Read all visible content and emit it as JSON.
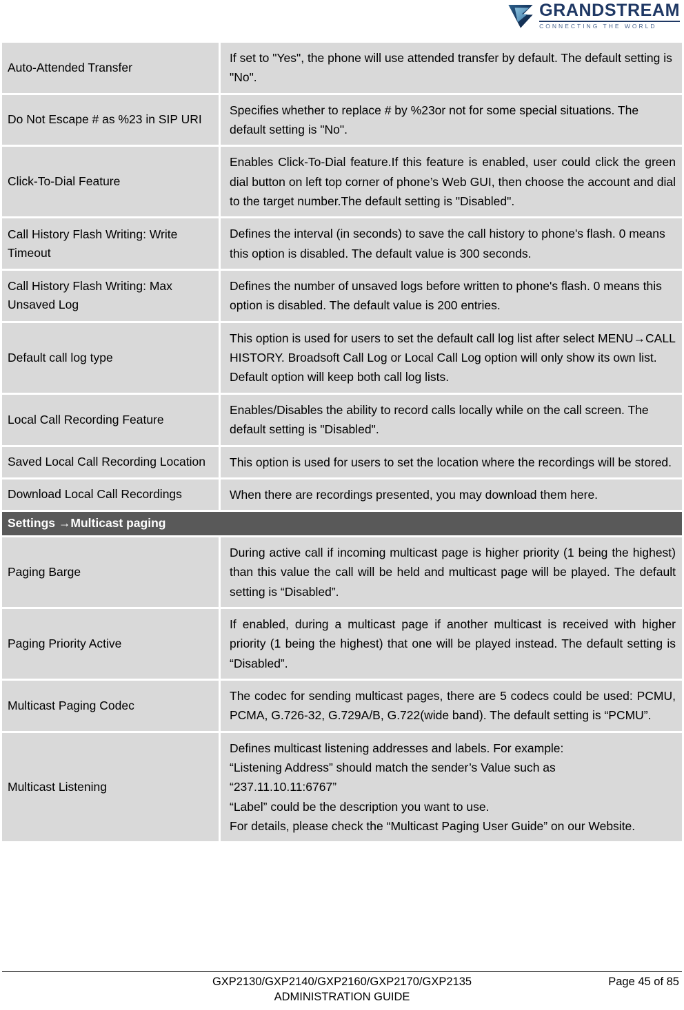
{
  "header": {
    "logo": {
      "icon": "grandstream-swoosh-logo",
      "wordmark": "GRANDSTREAM",
      "tagline": "CONNECTING THE WORLD",
      "brand_color": "#1f3864",
      "mark_color_dark": "#152b4e",
      "mark_color_light": "#5e9fc4"
    }
  },
  "colors": {
    "row_background": "#d9d9d9",
    "section_header_background": "#595959",
    "section_header_text": "#ffffff",
    "cell_gap": "#ffffff"
  },
  "table": {
    "rows": [
      {
        "type": "data",
        "parameter": "Auto-Attended Transfer",
        "align": "left",
        "description": [
          "If set to \"Yes\", the phone will use attended transfer by default. The default setting is \"No\"."
        ]
      },
      {
        "type": "data",
        "parameter": "Do Not Escape # as %23 in SIP URI",
        "align": "left",
        "description": [
          "Specifies whether to replace # by %23or not for some special situations. The default setting is \"No\"."
        ]
      },
      {
        "type": "data",
        "parameter": "Click-To-Dial Feature",
        "align": "justify",
        "description": [
          "Enables Click-To-Dial feature.If this feature is enabled, user could click the green dial button on left top corner of phone’s Web GUI, then choose the account and dial to the target number.The default setting is \"Disabled\"."
        ]
      },
      {
        "type": "data",
        "parameter": "Call History Flash Writing: Write Timeout",
        "align": "left",
        "description": [
          "Defines the interval (in seconds) to save the call history to phone's flash. 0 means this option is disabled. The default value is 300 seconds."
        ]
      },
      {
        "type": "data",
        "parameter": "Call History Flash Writing: Max Unsaved Log",
        "align": "left",
        "description": [
          "Defines the number of unsaved logs before written to phone's flash. 0 means this option is disabled. The default value is 200 entries."
        ]
      },
      {
        "type": "data",
        "parameter": "Default call log type",
        "align": "left",
        "description": [
          "This option is used for users to set the default call log list after select MENU→CALL HISTORY. Broadsoft Call Log or Local Call Log option will only show its own list. Default option will keep both call log lists."
        ]
      },
      {
        "type": "data",
        "parameter": "Local Call Recording Feature",
        "align": "left",
        "description": [
          "Enables/Disables the ability to record calls locally while on the call screen. The default setting is \"Disabled\"."
        ]
      },
      {
        "type": "data",
        "parameter": "Saved Local Call Recording Location",
        "align": "left",
        "description": [
          "This option is used for users to set the location where the recordings will be stored."
        ]
      },
      {
        "type": "data",
        "parameter": "Download Local Call Recordings",
        "align": "left",
        "description": [
          "When there are recordings presented, you may download them here."
        ]
      },
      {
        "type": "section",
        "title": "Settings →Multicast paging"
      },
      {
        "type": "data",
        "parameter": "Paging Barge",
        "align": "justify",
        "description": [
          "During active call if incoming multicast page is higher priority (1 being the highest) than this value the call will be held and multicast page will be played. The default setting is “Disabled”."
        ]
      },
      {
        "type": "data",
        "parameter": "Paging Priority Active",
        "align": "justify",
        "description": [
          "If enabled, during a multicast page if another multicast is received with higher priority (1 being the highest) that one will be played instead. The default setting is “Disabled”."
        ]
      },
      {
        "type": "data",
        "parameter": "Multicast Paging Codec",
        "align": "justify",
        "description": [
          "The codec for sending multicast pages, there are 5 codecs could be used: PCMU, PCMA, G.726-32, G.729A/B, G.722(wide band). The default setting is “PCMU”."
        ]
      },
      {
        "type": "data",
        "parameter": "Multicast Listening",
        "align": "justify",
        "description": [
          "Defines multicast listening addresses and labels. For example:",
          "“Listening Address” should match the sender’s Value such as",
          "“237.11.10.11:6767”",
          "“Label” could be the description you want to use.",
          "For details, please check the “Multicast Paging User Guide” on our Website."
        ]
      }
    ]
  },
  "footer": {
    "models": "GXP2130/GXP2140/GXP2160/GXP2170/GXP2135",
    "guide": "ADMINISTRATION GUIDE",
    "page": "Page 45 of 85"
  }
}
